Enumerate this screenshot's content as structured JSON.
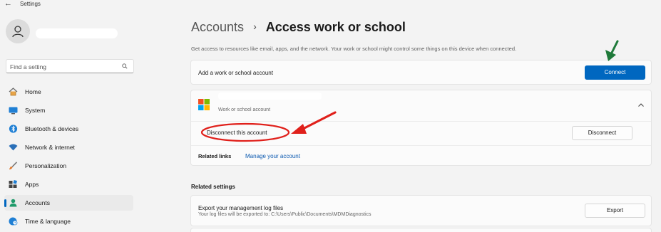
{
  "window": {
    "title": "Settings",
    "back_glyph": "←"
  },
  "sidebar": {
    "search": {
      "placeholder": "Find a setting",
      "icon": "search-icon"
    },
    "items": [
      {
        "label": "Home",
        "icon": "home-icon",
        "active": false
      },
      {
        "label": "System",
        "icon": "system-icon",
        "active": false
      },
      {
        "label": "Bluetooth & devices",
        "icon": "bluetooth-icon",
        "active": false
      },
      {
        "label": "Network & internet",
        "icon": "wifi-icon",
        "active": false
      },
      {
        "label": "Personalization",
        "icon": "brush-icon",
        "active": false
      },
      {
        "label": "Apps",
        "icon": "apps-icon",
        "active": false
      },
      {
        "label": "Accounts",
        "icon": "accounts-icon",
        "active": true
      },
      {
        "label": "Time & language",
        "icon": "globe-clock-icon",
        "active": false
      }
    ]
  },
  "main": {
    "breadcrumb": {
      "parent": "Accounts",
      "separator": "›",
      "current": "Access work or school"
    },
    "description": "Get access to resources like email, apps, and the network. Your work or school might control some things on this device when connected.",
    "add_account": {
      "label": "Add a work or school account",
      "button": "Connect"
    },
    "account": {
      "type_label": "Work or school account",
      "disconnect_label": "Disconnect this account",
      "disconnect_button": "Disconnect",
      "related_links_label": "Related links",
      "manage_link": "Manage your account"
    },
    "related_settings": {
      "title": "Related settings",
      "export": {
        "title": "Export your management log files",
        "subtitle": "Your log files will be exported to: C:\\Users\\Public\\Documents\\MDMDiagnostics",
        "button": "Export"
      }
    }
  },
  "colors": {
    "accent": "#0067c0",
    "annotation_red": "#e0201b",
    "annotation_green": "#1f7a3a",
    "background": "#f3f3f3"
  }
}
